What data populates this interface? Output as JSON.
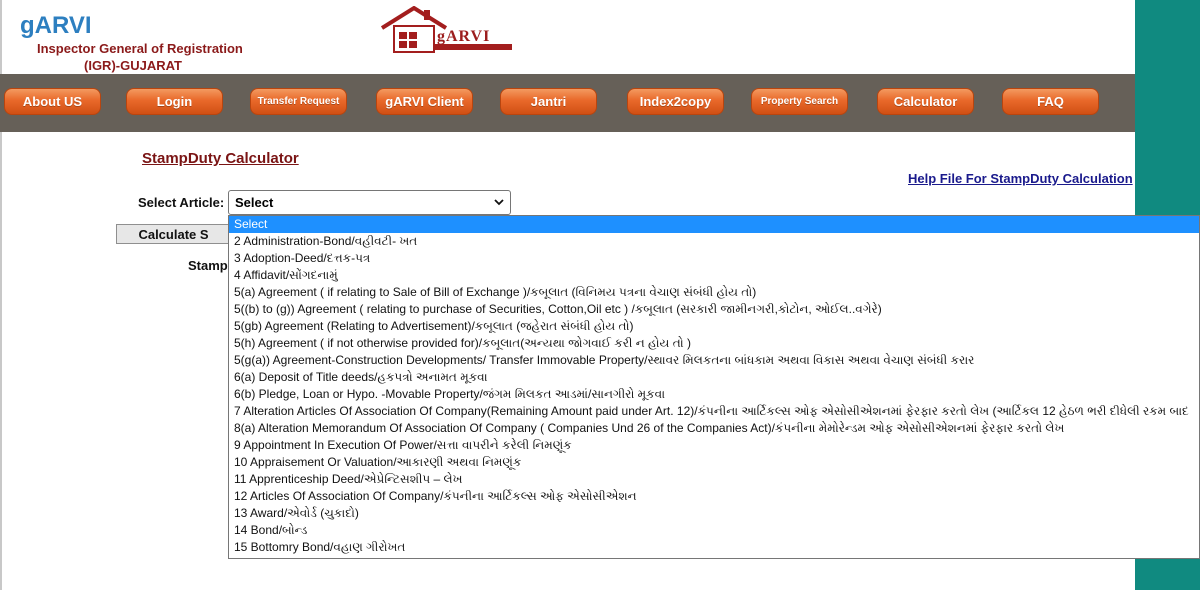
{
  "brand": {
    "title": "gARVI",
    "subtitle_line1": "Inspector General of Registration",
    "subtitle_line2": "(IGR)-GUJARAT",
    "logo_text": "gARVI"
  },
  "nav": [
    {
      "label": "About US",
      "name": "nav-about-us"
    },
    {
      "label": "Login",
      "name": "nav-login"
    },
    {
      "label": "Transfer Request",
      "name": "nav-transfer-request",
      "small": true
    },
    {
      "label": "gARVI Client",
      "name": "nav-garvi-client"
    },
    {
      "label": "Jantri",
      "name": "nav-jantri"
    },
    {
      "label": "Index2copy",
      "name": "nav-index2copy"
    },
    {
      "label": "Property Search",
      "name": "nav-property-search",
      "small": true
    },
    {
      "label": "Calculator",
      "name": "nav-calculator"
    },
    {
      "label": "FAQ",
      "name": "nav-faq"
    }
  ],
  "page": {
    "title": "StampDuty Calculator",
    "help_link": "Help File For StampDuty Calculation",
    "select_label": "Select Article:",
    "select_value": "Select",
    "calculate_button": "Calculate S",
    "stamp_label": "Stamp"
  },
  "dropdown_options": [
    "Select",
    "2 Administration-Bond/વહીવટી- ખત",
    "3 Adoption-Deed/દત્તક-પત્ર",
    "4 Affidavit/સોંગદનામું",
    "5(a) Agreement ( if relating to Sale of Bill of Exchange )/કબૂલાત (વિનિમય પત્રના વેચાણ સંબંધી હોય તો)",
    "5((b) to (g)) Agreement ( relating to purchase of Securities, Cotton,Oil etc ) /કબૂલાત (સરકારી જામીનગરી,કોટોન, ઓઈલ..વગેરે)",
    "5(gb) Agreement (Relating to Advertisement)/કબૂલાત (જહેરાત સંબંધી હોય તો)",
    "5(h) Agreement ( if not otherwise provided for)/કબૂલાત(અન્યથા જોગવાઈ કરી ન હોય તો )",
    "5(g(a)) Agreement-Construction Developments/ Transfer Immovable Property/સ્થાવર મિલકતના બાંધકામ અથવા વિકાસ અથવા વેચાણ સંબંધી કરાર",
    "6(a) Deposit of Title deeds/હકપત્રો અનામત મૂકવા",
    "6(b) Pledge, Loan or Hypo. -Movable Property/જંગમ મિલકત આડમાં/સાનગીરો મૂકવા",
    "7 Alteration Articles Of Association Of Company(Remaining Amount paid under Art. 12)/કંપનીના આર્ટિકલ્સ ઓફ એસોસીએશનમાં ફેરફાર કરતો લેખ (આર્ટિકલ 12 હેઠળ ભરી દીધેલી રકમ બાદ",
    "8(a) Alteration Memorandum Of Association Of Company ( Companies Und 26 of the Companies Act)/કંપનીના મેમોરેન્ડમ ઓફ એસોસીએશનમાં ફેરફાર કરતો લેખ",
    "9 Appointment In Execution Of Power/સત્તા વાપરીને કરેલી નિમણૂંક",
    "10 Appraisement Or Valuation/આકારણી અથવા નિમણૂંક",
    "11 Apprenticeship Deed/એપ્રેન્ટિસશીપ – લેખ",
    "12 Articles Of Association Of Company/કંપનીના આર્ટિકલ્સ ઓફ એસોસીએશન",
    "13 Award/એવોર્ડ (ચુકાદો)",
    "14 Bond/બોન્ડ",
    "15 Bottomry Bond/વહાણ ગીરોખત"
  ],
  "colors": {
    "nav_button": "#e9692a",
    "navbar_bg": "#666058",
    "brand_blue": "#2d7fc0",
    "brand_red": "#8b1a1a",
    "right_band": "#108a80",
    "selected_option": "#1e90ff"
  },
  "icons": {
    "logo": "house-logo-icon",
    "select_arrow": "chevron-down-icon"
  }
}
